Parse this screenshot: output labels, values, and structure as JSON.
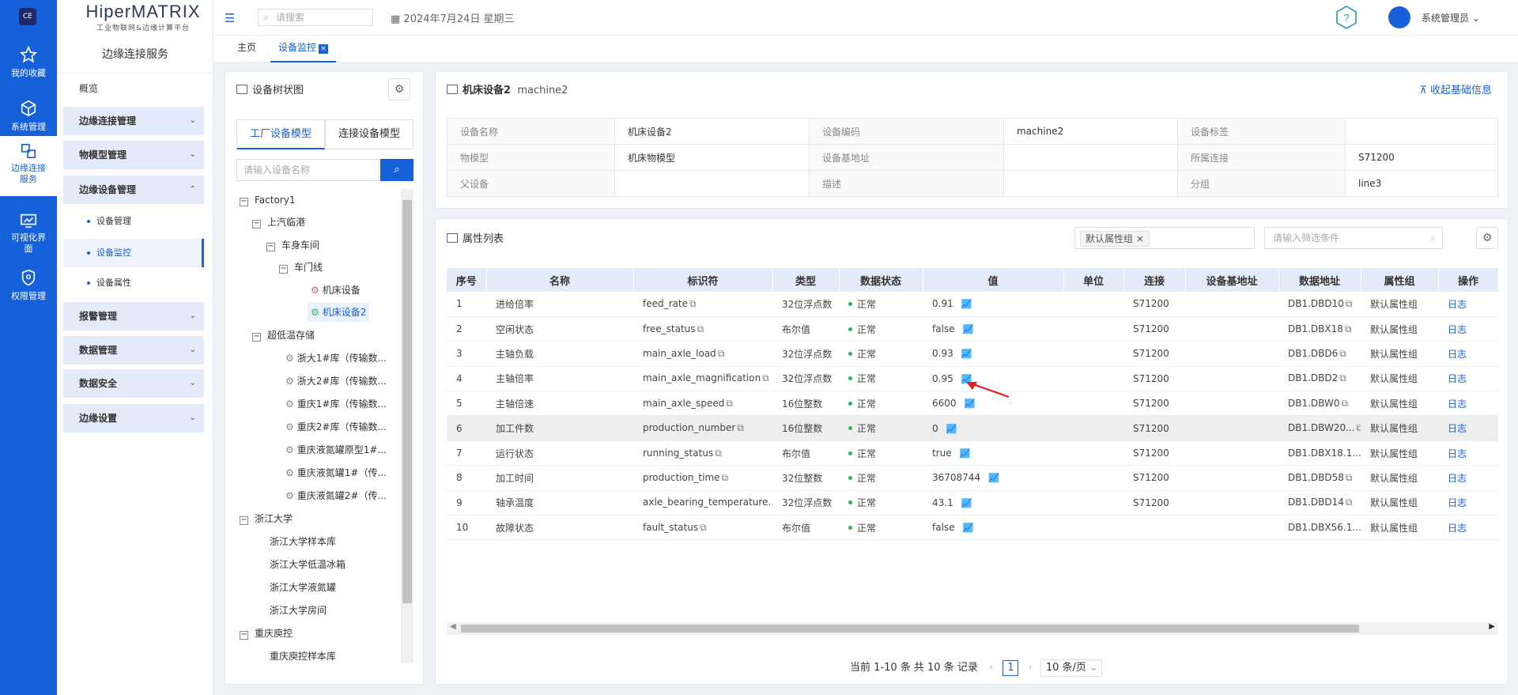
{
  "rail": {
    "items": [
      {
        "label": "我的收藏",
        "icon": "star-icon"
      },
      {
        "label": "系统管理",
        "icon": "cube-icon"
      },
      {
        "label": "边缘连接服务",
        "icon": "connection-icon"
      },
      {
        "label": "可视化界面",
        "icon": "monitor-chart-icon"
      },
      {
        "label": "权限管理",
        "icon": "shield-icon"
      }
    ]
  },
  "sidebar": {
    "brand": "HiperMATRIX",
    "brand_sub": "工业物联网&边缘计算平台",
    "title": "边缘连接服务",
    "overview": "概览",
    "groups": [
      "边缘连接管理",
      "物模型管理",
      "边缘设备管理",
      "报警管理",
      "数据管理",
      "数据安全",
      "边缘设置"
    ],
    "leaves": [
      "设备管理",
      "设备监控",
      "设备属性"
    ]
  },
  "header": {
    "search_placeholder": "请搜索",
    "date": "2024年7月24日 星期三",
    "user": "系统管理员"
  },
  "tabs": [
    "主页",
    "设备监控"
  ],
  "tree": {
    "title": "设备树状图",
    "model_tabs": [
      "工厂设备模型",
      "连接设备模型"
    ],
    "search_placeholder": "请输入设备名称",
    "nodes": [
      "Factory1",
      "上汽临港",
      "车身车间",
      "车门线",
      "机床设备",
      "机床设备2",
      "超低温存储",
      "浙大1#库（传输数...",
      "浙大2#库（传输数...",
      "重庆1#库（传输数...",
      "重庆2#库（传输数...",
      "重庆液氮罐原型1#...",
      "重庆液氮罐1#（传...",
      "重庆液氮罐2#（传...",
      "浙江大学",
      "浙江大学样本库",
      "浙江大学低温冰箱",
      "浙江大学液氮罐",
      "浙江大学房间",
      "重庆庾控",
      "重庆庾控样本库"
    ]
  },
  "info": {
    "title": "机床设备2",
    "code": "machine2",
    "collapse_label": "收起基础信息",
    "rows": [
      [
        "设备名称",
        "机床设备2",
        "设备编码",
        "machine2",
        "设备标签",
        ""
      ],
      [
        "物模型",
        "机床物模型",
        "设备基地址",
        "",
        "所属连接",
        "S71200"
      ],
      [
        "父设备",
        "",
        "描述",
        "",
        "分组",
        "line3"
      ]
    ]
  },
  "attr": {
    "title": "属性列表",
    "filter_tag": "默认属性组",
    "filter_placeholder": "请输入筛选条件",
    "columns": [
      "序号",
      "名称",
      "标识符",
      "类型",
      "数据状态",
      "值",
      "单位",
      "连接",
      "设备基地址",
      "数据地址",
      "属性组",
      "操作"
    ],
    "rows": [
      [
        "1",
        "进给倍率",
        "feed_rate",
        "32位浮点数",
        "正常",
        "0.91",
        "",
        "S71200",
        "",
        "DB1.DBD10",
        "默认属性组",
        "日志"
      ],
      [
        "2",
        "空闲状态",
        "free_status",
        "布尔值",
        "正常",
        "false",
        "",
        "S71200",
        "",
        "DB1.DBX18",
        "默认属性组",
        "日志"
      ],
      [
        "3",
        "主轴负载",
        "main_axle_load",
        "32位浮点数",
        "正常",
        "0.93",
        "",
        "S71200",
        "",
        "DB1.DBD6",
        "默认属性组",
        "日志"
      ],
      [
        "4",
        "主轴倍率",
        "main_axle_magnification",
        "32位浮点数",
        "正常",
        "0.95",
        "",
        "S71200",
        "",
        "DB1.DBD2",
        "默认属性组",
        "日志"
      ],
      [
        "5",
        "主轴倍速",
        "main_axle_speed",
        "16位整数",
        "正常",
        "6600",
        "",
        "S71200",
        "",
        "DB1.DBW0",
        "默认属性组",
        "日志"
      ],
      [
        "6",
        "加工件数",
        "production_number",
        "16位整数",
        "正常",
        "0",
        "",
        "S71200",
        "",
        "DB1.DBW20...",
        "默认属性组",
        "日志"
      ],
      [
        "7",
        "运行状态",
        "running_status",
        "布尔值",
        "正常",
        "true",
        "",
        "S71200",
        "",
        "DB1.DBX18.1...",
        "默认属性组",
        "日志"
      ],
      [
        "8",
        "加工时间",
        "production_time",
        "32位整数",
        "正常",
        "36708744",
        "",
        "S71200",
        "",
        "DB1.DBD58",
        "默认属性组",
        "日志"
      ],
      [
        "9",
        "轴承温度",
        "axle_bearing_temperature...",
        "32位浮点数",
        "正常",
        "43.1",
        "",
        "S71200",
        "",
        "DB1.DBD14",
        "默认属性组",
        "日志"
      ],
      [
        "10",
        "故障状态",
        "fault_status",
        "布尔值",
        "正常",
        "false",
        "",
        "",
        "",
        "DB1.DBX56.1...",
        "默认属性组",
        "日志"
      ]
    ],
    "pager_text": "当前 1-10 条 共 10 条 记录",
    "page": "1",
    "page_size": "10 条/页"
  }
}
